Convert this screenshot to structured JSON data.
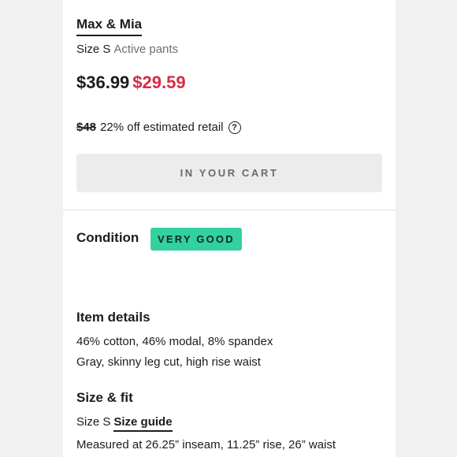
{
  "product": {
    "brand": "Max & Mia",
    "size_label": "Size S",
    "category": "Active pants",
    "price_original": "$36.99",
    "price_sale": "$29.59",
    "retail_strike": "$48",
    "retail_text": "22% off estimated retail",
    "help_icon_glyph": "?"
  },
  "cart": {
    "button_label": "IN YOUR CART"
  },
  "condition": {
    "title": "Condition",
    "badge": "VERY GOOD",
    "badge_color": "#33d1a0"
  },
  "item_details": {
    "title": "Item details",
    "lines": [
      "46% cotton, 46% modal, 8% spandex",
      "Gray, skinny leg cut, high rise waist"
    ]
  },
  "size_fit": {
    "title": "Size & fit",
    "size_label": "Size S",
    "guide_link": "Size guide",
    "measurements": "Measured at 26.25” inseam, 11.25” rise, 26” waist"
  },
  "colors": {
    "sale_price": "#d62d44",
    "button_bg": "#ececec"
  }
}
